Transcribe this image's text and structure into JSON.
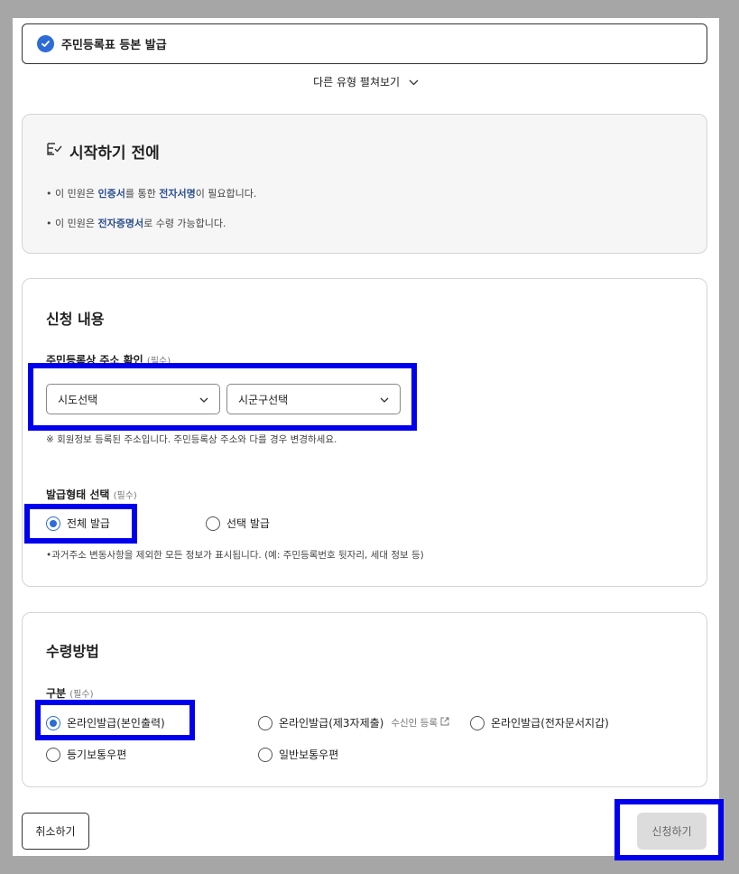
{
  "header": {
    "title": "주민등록표 등본 발급"
  },
  "more_types": {
    "label": "다른 유형 펼쳐보기"
  },
  "before_start": {
    "title": "시작하기 전에",
    "note1": {
      "p1": "• 이 민원은 ",
      "b1": "인증서",
      "p2": "를 통한 ",
      "b2": "전자서명",
      "p3": "이 필요합니다."
    },
    "note2": {
      "p1": "• 이 민원은 ",
      "b1": "전자증명서",
      "p2": "로 수령 가능합니다."
    }
  },
  "application": {
    "title": "신청 내용",
    "address": {
      "label": "주민등록상 주소 확인",
      "required": "(필수)",
      "sido_placeholder": "시도선택",
      "sigungu_placeholder": "시군구선택",
      "hint": "※ 회원정보 등록된 주소입니다. 주민등록상 주소와 다를 경우 변경하세요."
    },
    "issue_type": {
      "label": "발급형태 선택",
      "required": "(필수)",
      "options": [
        "전체 발급",
        "선택 발급"
      ],
      "selected": "전체 발급",
      "hint": "•과거주소 변동사항을 제외한 모든 정보가 표시됩니다. (예: 주민등록번호 뒷자리, 세대 정보 등)"
    }
  },
  "receive": {
    "title": "수령방법",
    "label": "구분",
    "required": "(필수)",
    "options": [
      "온라인발급(본인출력)",
      "온라인발급(제3자제출)",
      "온라인발급(전자문서지갑)",
      "등기보통우편",
      "일반보통우편"
    ],
    "selected": "온라인발급(본인출력)",
    "recipient_link": "수신인 등록"
  },
  "buttons": {
    "cancel": "취소하기",
    "submit": "신청하기"
  },
  "colors": {
    "accent": "#2d6bd8",
    "highlight": "#0000ee",
    "disabled_button": "#dcdcdc"
  }
}
